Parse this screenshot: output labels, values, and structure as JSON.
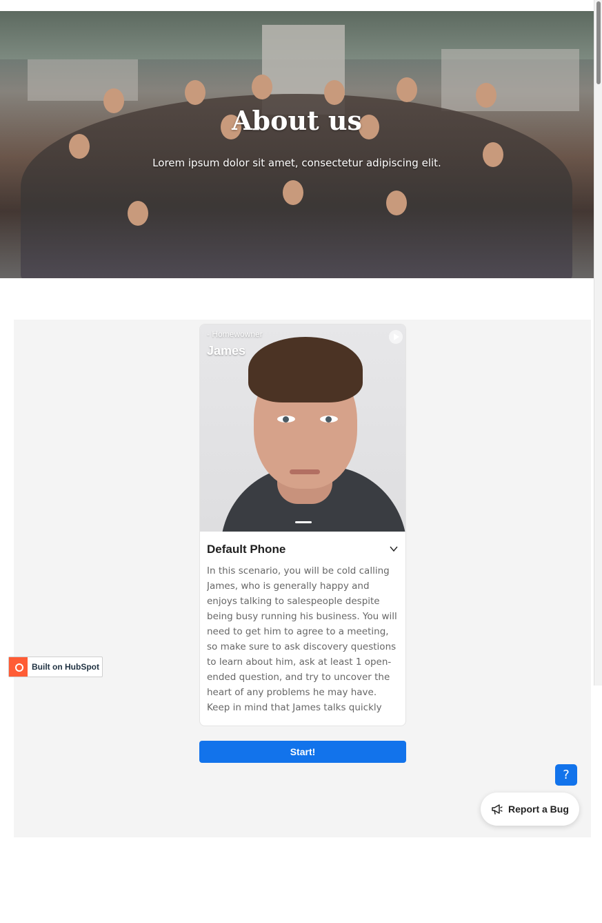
{
  "hero": {
    "title": "About us",
    "subtitle": "Lorem ipsum dolor sit amet, consectetur adipiscing elit."
  },
  "card": {
    "role": "- Homewowner",
    "name": "James",
    "title": "Default Phone",
    "description": "In this scenario, you will be cold calling James, who is generally happy and enjoys talking to salespeople despite being busy running his business. You will need to get him to agree to a meeting, so make sure to ask discovery questions to learn about him, ask at least 1 open-ended question, and try to uncover the heart of any problems he may have. Keep in mind that James talks quickly and is very busy but…",
    "start_label": "Start!"
  },
  "hubspot": {
    "label": "Built on HubSpot"
  },
  "help": {
    "label": "?"
  },
  "report": {
    "label": "Report a Bug"
  },
  "colors": {
    "primary": "#1273eb",
    "hubspot_orange": "#ff5c35",
    "section_bg": "#f4f4f4"
  }
}
